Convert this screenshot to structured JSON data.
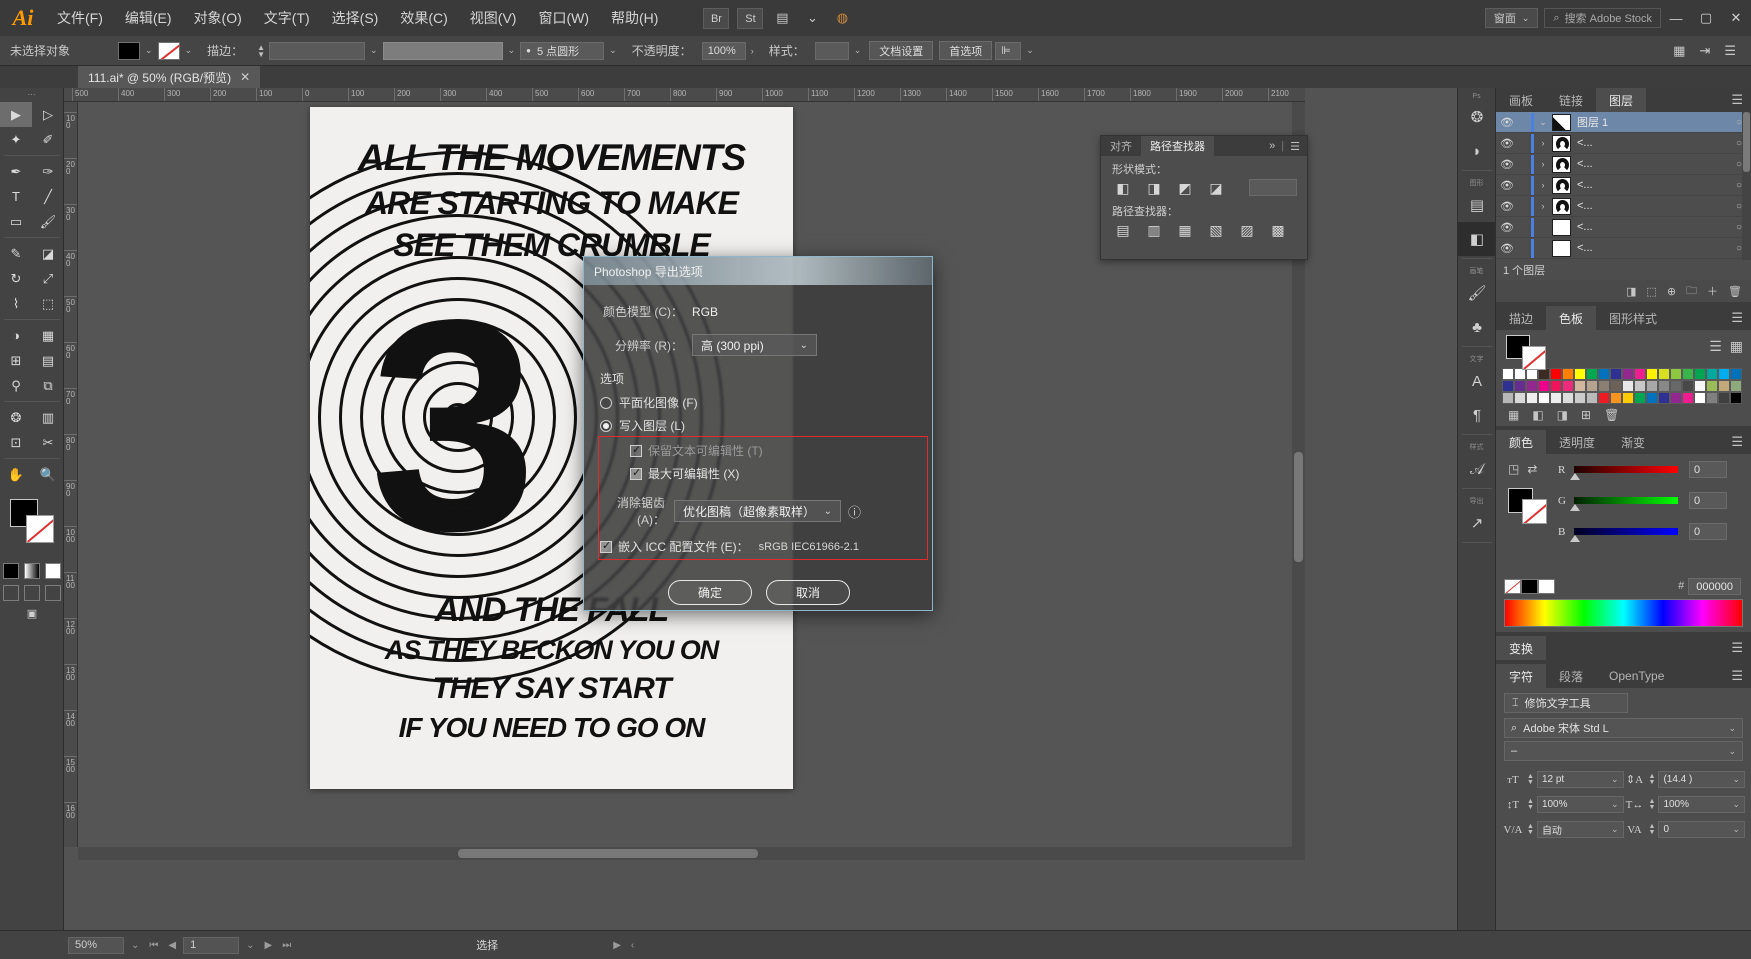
{
  "app": {
    "logo": "Ai"
  },
  "menubar": {
    "items": [
      {
        "label": "文件(F)"
      },
      {
        "label": "编辑(E)"
      },
      {
        "label": "对象(O)"
      },
      {
        "label": "文字(T)"
      },
      {
        "label": "选择(S)"
      },
      {
        "label": "效果(C)"
      },
      {
        "label": "视图(V)"
      },
      {
        "label": "窗口(W)"
      },
      {
        "label": "帮助(H)"
      }
    ],
    "bridge": "Br",
    "stock": "St",
    "arrange_caret": "⌄",
    "workspace": "ண面",
    "workspace_label": "窗面",
    "search_placeholder": "搜索 Adobe Stock",
    "min": "—",
    "max": "▢",
    "close": "✕"
  },
  "controlbar": {
    "selection_status": "未选择对象",
    "stroke_label": "描边：",
    "stroke_weight": "",
    "brush_value": "",
    "style_dot": "●",
    "style_value": "5 点圆形",
    "opacity_label": "不透明度：",
    "opacity_value": "100%",
    "style_label": "样式：",
    "doc_setup": "文档设置",
    "preferences": "首选项",
    "align_caret": "⌄"
  },
  "document_tab": {
    "title": "111.ai* @ 50% (RGB/预览)",
    "close": "✕"
  },
  "toolbox": {
    "header": "●●",
    "tools": [
      {
        "name": "selection-tool",
        "glyph": "▶"
      },
      {
        "name": "direct-selection-tool",
        "glyph": "▷"
      },
      {
        "name": "magic-wand-tool",
        "glyph": "✦"
      },
      {
        "name": "lasso-tool",
        "glyph": "✐"
      },
      {
        "name": "pen-tool",
        "glyph": "✒"
      },
      {
        "name": "curvature-tool",
        "glyph": "✑"
      },
      {
        "name": "type-tool",
        "glyph": "T"
      },
      {
        "name": "line-segment-tool",
        "glyph": "╱"
      },
      {
        "name": "rectangle-tool",
        "glyph": "▭"
      },
      {
        "name": "paintbrush-tool",
        "glyph": "🖌"
      },
      {
        "name": "shaper-tool",
        "glyph": "✎"
      },
      {
        "name": "eraser-tool",
        "glyph": "◪"
      },
      {
        "name": "rotate-tool",
        "glyph": "↻"
      },
      {
        "name": "scale-tool",
        "glyph": "⤢"
      },
      {
        "name": "width-tool",
        "glyph": "⌇"
      },
      {
        "name": "free-transform-tool",
        "glyph": "⬚"
      },
      {
        "name": "shape-builder-tool",
        "glyph": "◑"
      },
      {
        "name": "perspective-grid-tool",
        "glyph": "▦"
      },
      {
        "name": "mesh-tool",
        "glyph": "⊞"
      },
      {
        "name": "gradient-tool",
        "glyph": "▤"
      },
      {
        "name": "eyedropper-tool",
        "glyph": "⚲"
      },
      {
        "name": "blend-tool",
        "glyph": "⧉"
      },
      {
        "name": "symbol-sprayer-tool",
        "glyph": "❂"
      },
      {
        "name": "column-graph-tool",
        "glyph": "▥"
      },
      {
        "name": "artboard-tool",
        "glyph": "⊡"
      },
      {
        "name": "slice-tool",
        "glyph": "✂"
      },
      {
        "name": "hand-tool",
        "glyph": "✋"
      },
      {
        "name": "zoom-tool",
        "glyph": "🔍"
      }
    ]
  },
  "canvas": {
    "zoom": "50%",
    "ruler_units_h": [
      "500",
      "400",
      "300",
      "200",
      "100",
      "0",
      "100",
      "200",
      "300",
      "400",
      "500",
      "600",
      "700",
      "800",
      "900",
      "1000",
      "1100",
      "1200",
      "1300",
      "1400",
      "1500",
      "1600",
      "1700",
      "1800",
      "1900",
      "2000",
      "2100"
    ],
    "ruler_units_v": [
      "100",
      "200",
      "300",
      "400",
      "500",
      "600",
      "700",
      "800",
      "900",
      "1000",
      "1100",
      "1200",
      "1300",
      "1400",
      "1500",
      "1600"
    ],
    "poster_lines": [
      "ALL THE MOVEMENTS",
      "ARE STARTING TO MAKE",
      "SEE THEM CRUMBLE",
      "AND THE FALL",
      "AS THEY BECKON YOU ON",
      "THEY SAY START",
      "IF YOU NEED TO GO ON"
    ],
    "poster_numeral": "3"
  },
  "dialog": {
    "title": "Photoshop 导出选项",
    "color_model_label": "颜色模型 (C)：",
    "color_model_value": "RGB",
    "resolution_label": "分辨率 (R)：",
    "resolution_value": "高 (300 ppi)",
    "options_label": "选项",
    "flatten_label": "平面化图像 (F)",
    "flatten_checked": false,
    "write_layers_label": "写入图层 (L)",
    "write_layers_checked": true,
    "preserve_text_label": "保留文本可编辑性 (T)",
    "preserve_text_checked": true,
    "preserve_text_disabled": true,
    "max_editability_label": "最大可编辑性 (X)",
    "max_editability_checked": true,
    "antialias_label": "消除锯齿 (A)：",
    "antialias_value": "优化图稿（超像素取样）",
    "info_icon": "ⓘ",
    "icc_label": "嵌入 ICC 配置文件 (E)：",
    "icc_checked": true,
    "icc_value": "sRGB IEC61966-2.1",
    "ok_button": "确定",
    "cancel_button": "取消",
    "highlight_color": "#e02b2b",
    "caret": "⌄"
  },
  "pathfinder_panel": {
    "tabs": [
      {
        "label": "对齐",
        "active": false
      },
      {
        "label": "路径查找器",
        "active": true
      }
    ],
    "expand": "»",
    "menu": "☰",
    "shape_modes_label": "形状模式：",
    "shape_modes": [
      {
        "name": "unite",
        "glyph": "◧"
      },
      {
        "name": "minus-front",
        "glyph": "◨"
      },
      {
        "name": "intersect",
        "glyph": "◩"
      },
      {
        "name": "exclude",
        "glyph": "◪"
      }
    ],
    "expand_button": "",
    "pathfinders_label": "路径查找器：",
    "pathfinders": [
      {
        "name": "divide",
        "glyph": "▤"
      },
      {
        "name": "trim",
        "glyph": "▥"
      },
      {
        "name": "merge",
        "glyph": "▦"
      },
      {
        "name": "crop",
        "glyph": "▧"
      },
      {
        "name": "outline",
        "glyph": "▨"
      },
      {
        "name": "minus-back",
        "glyph": "▩"
      }
    ]
  },
  "dock_icons": {
    "groups": [
      {
        "header": "Ps",
        "items": [
          {
            "name": "brushes-icon",
            "glyph": "❂"
          },
          {
            "name": "symbols-icon",
            "glyph": "◗"
          }
        ]
      },
      {
        "header": "图形",
        "items": [
          {
            "name": "align-icon",
            "glyph": "▤"
          },
          {
            "name": "pathfinder-icon",
            "glyph": "◧",
            "selected": true
          }
        ]
      },
      {
        "header": "画笔",
        "items": [
          {
            "name": "brush-library-icon",
            "glyph": "🖌"
          },
          {
            "name": "symbol-icon",
            "glyph": "♣"
          }
        ]
      },
      {
        "header": "文字",
        "items": [
          {
            "name": "character-styles-icon",
            "glyph": "A"
          },
          {
            "name": "paragraph-styles-icon",
            "glyph": "¶"
          }
        ]
      },
      {
        "header": "样式",
        "items": [
          {
            "name": "graphic-styles-icon",
            "glyph": "𝒜"
          }
        ]
      },
      {
        "header": "导出",
        "items": [
          {
            "name": "asset-export-icon",
            "glyph": "↗"
          }
        ]
      }
    ]
  },
  "layers_panel": {
    "tabs": [
      {
        "label": "画板",
        "active": false
      },
      {
        "label": "链接",
        "active": false
      },
      {
        "label": "图层",
        "active": true
      }
    ],
    "menu": "☰",
    "rows": [
      {
        "name": "图层 1",
        "selected": true,
        "expand": "⌄",
        "thumb": "layer",
        "dot": "○"
      },
      {
        "name": "<...",
        "selected": false,
        "expand": "›",
        "thumb": "arc1",
        "dot": "○"
      },
      {
        "name": "<...",
        "selected": false,
        "expand": "›",
        "thumb": "arc2",
        "dot": "○"
      },
      {
        "name": "<...",
        "selected": false,
        "expand": "›",
        "thumb": "arc3",
        "dot": "○"
      },
      {
        "name": "<...",
        "selected": false,
        "expand": "›",
        "thumb": "arc4",
        "dot": "○"
      },
      {
        "name": "<...",
        "selected": false,
        "expand": "",
        "thumb": "blank",
        "dot": "○"
      },
      {
        "name": "<...",
        "selected": false,
        "expand": "",
        "thumb": "blank",
        "dot": "○"
      },
      {
        "name": "<...",
        "selected": false,
        "expand": "›",
        "thumb": "text",
        "dot": "○"
      }
    ],
    "count_label": "1 个图层",
    "eye_icon": "👁",
    "footer_icons": [
      "◨",
      "⬚",
      "⊕",
      "🗀",
      "＋",
      "🗑"
    ]
  },
  "swatches_panel": {
    "tabs": [
      {
        "label": "描边",
        "active": false
      },
      {
        "label": "色板",
        "active": true
      },
      {
        "label": "图形样式",
        "active": false
      }
    ],
    "menu": "☰",
    "view_icons": [
      "☰",
      "▦"
    ],
    "colors_row1": [
      "#ffffff",
      "#ffffff",
      "#ffffff",
      "#3b2b22",
      "#ff0000",
      "#ff7f00",
      "#ffff00",
      "#00a94f",
      "#0072bc",
      "#2e3192",
      "#92278f",
      "#ed1c8f"
    ],
    "colors_row2": [
      "#fff200",
      "#d7df23",
      "#8dc63f",
      "#39b54a",
      "#00a651",
      "#00a99d",
      "#00aeef",
      "#0072bc",
      "#2e3192",
      "#662d91",
      "#92278f",
      "#ec008c"
    ],
    "colors_row3": [
      "#ed145b",
      "#ee2a7b",
      "#d4b59e",
      "#b5a28f",
      "#8a7f72",
      "#6d6258",
      "#e8e8e8",
      "#c8c8c8",
      "#a8a8a8",
      "#888888",
      "#686868",
      "#484848"
    ],
    "colors_row4": [
      "#f5f5f5",
      "#9bbb59",
      "#c3a87a",
      "#8ea97c",
      "#b7b7b7",
      "#d9d9d9",
      "#efefef",
      "#ffffff",
      "#ededed",
      "#dcdcdc",
      "#cccccc",
      "#bababa"
    ],
    "colors_row5": [
      "#ed1c24",
      "#f7941e",
      "#ffcb05",
      "#00a651",
      "#0072bc",
      "#2e3192",
      "#92278f",
      "#ed1c8f",
      "#ffffff",
      "#808080",
      "#404040",
      "#000000"
    ],
    "footer_icons": [
      "▦",
      "◧",
      "◨",
      "⊞",
      "🗑"
    ]
  },
  "color_panel": {
    "tabs": [
      {
        "label": "颜色",
        "active": true
      },
      {
        "label": "透明度",
        "active": false
      },
      {
        "label": "渐变",
        "active": false
      }
    ],
    "menu": "☰",
    "sliders": [
      {
        "label": "R",
        "value": "0",
        "color": "#ff0000"
      },
      {
        "label": "G",
        "value": "0",
        "color": "#00ff00"
      },
      {
        "label": "B",
        "value": "0",
        "color": "#0000ff"
      }
    ],
    "hex_label": "#",
    "hex_value": "000000",
    "none_glyph": "╱"
  },
  "transform_panel": {
    "tabs": [
      {
        "label": "变换",
        "active": true
      }
    ],
    "menu": "☰"
  },
  "character_panel": {
    "tabs": [
      {
        "label": "字符",
        "active": true
      },
      {
        "label": "段落",
        "active": false
      },
      {
        "label": "OpenType",
        "active": false
      }
    ],
    "menu": "☰",
    "touch_type_button": "修饰文字工具",
    "touch_type_icon": "⌶",
    "font_family": "Adobe 宋体 Std L",
    "font_style": "–",
    "search_icon": "⌕",
    "fields": [
      {
        "name": "font-size",
        "icon": "ᴛT",
        "value": "12 pt"
      },
      {
        "name": "leading",
        "icon": "⇕A",
        "value": "(14.4 )"
      },
      {
        "name": "vertical-scale",
        "icon": "↕T",
        "value": "100%"
      },
      {
        "name": "horizontal-scale",
        "icon": "T↔",
        "value": "100%"
      },
      {
        "name": "kerning",
        "icon": "V/A",
        "value": "自动"
      },
      {
        "name": "tracking",
        "icon": "VA",
        "value": "0"
      }
    ]
  },
  "statusbar": {
    "zoom": "50%",
    "zoom_caret": "⌄",
    "first": "⏮",
    "prev": "◀",
    "page": "1",
    "page_caret": "⌄",
    "next": "▶",
    "last": "⏭",
    "status_text": "选择",
    "nav_right": "▶",
    "nav_left": "‹"
  }
}
